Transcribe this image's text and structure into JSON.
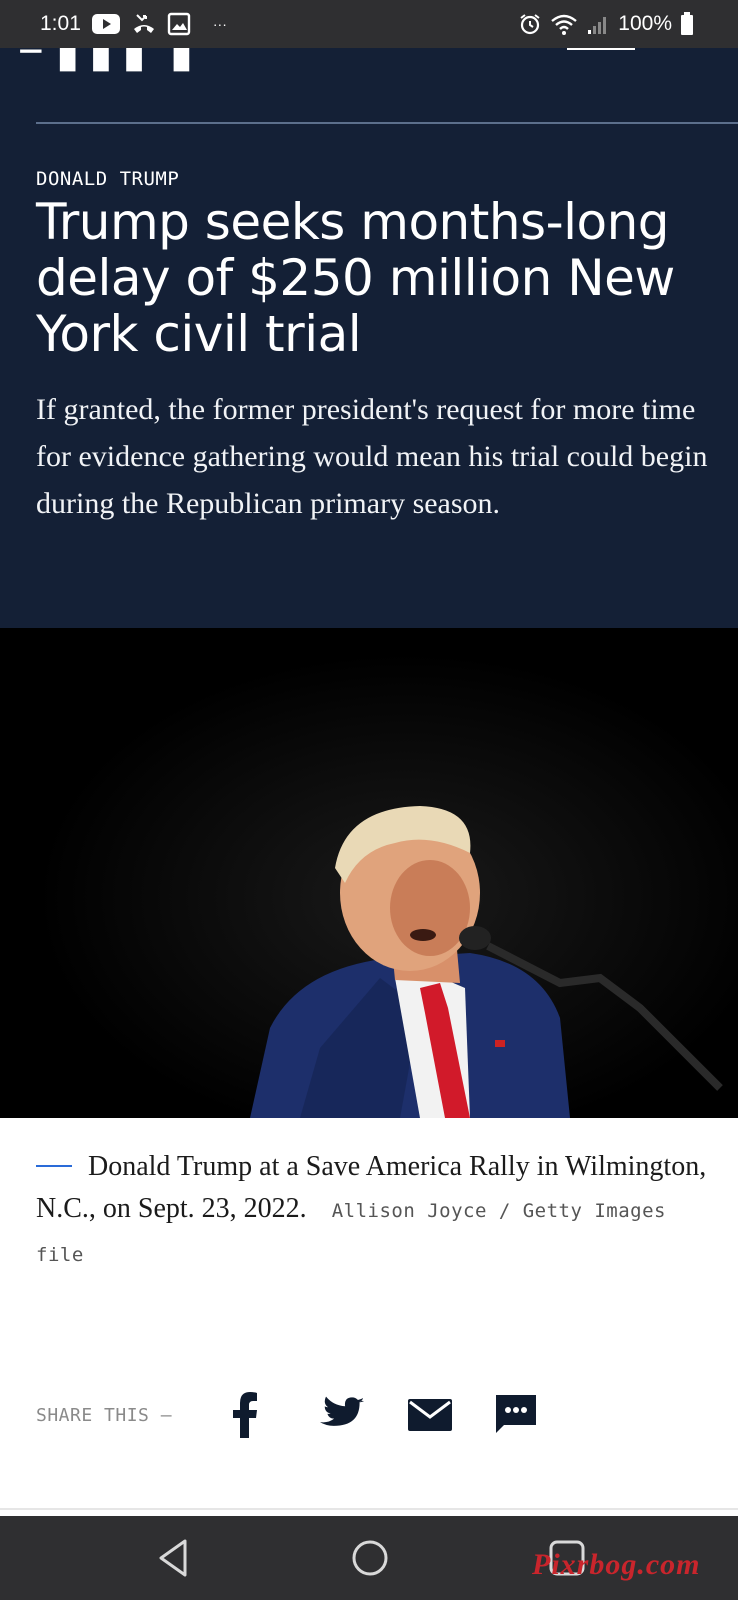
{
  "status_bar": {
    "time": "1:01",
    "more": "···",
    "battery": "100%",
    "icons": [
      "youtube-icon",
      "missed-call-icon",
      "gallery-icon",
      "alarm-icon",
      "wifi-icon",
      "signal-icon",
      "battery-icon"
    ]
  },
  "article": {
    "kicker": "DONALD TRUMP",
    "headline": "Trump seeks months-long delay of $250 million New York civil trial",
    "dek": "If granted, the former president's request for more time for evidence gathering would mean his trial could begin during the Republican primary season.",
    "photo": {
      "caption": "Donald Trump at a Save America Rally in Wilmington, N.C., on Sept. 23, 2022.",
      "credit": "Allison Joyce / Getty Images file"
    }
  },
  "share": {
    "label": "SHARE THIS —",
    "buttons": [
      "facebook-icon",
      "twitter-icon",
      "email-icon",
      "comments-icon"
    ]
  },
  "nav_bar": {
    "buttons": [
      "back-icon",
      "home-icon",
      "recents-icon"
    ]
  },
  "watermark": "Pixrbog.com",
  "colors": {
    "hero_bg": "#142036",
    "system_bar": "#2f2f31",
    "caption_accent": "#2a6bd8",
    "tie_red": "#d11a2a",
    "suit_navy": "#1d2f6b"
  }
}
